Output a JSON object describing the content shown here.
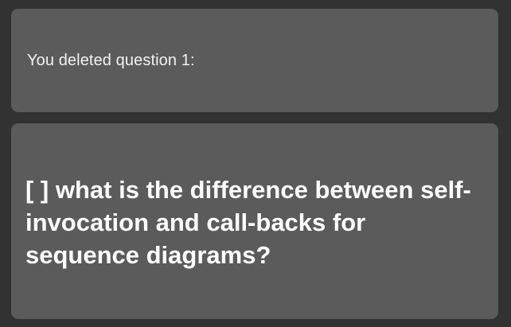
{
  "notice": {
    "text": "You deleted question 1:"
  },
  "question": {
    "text": "[ ] what is the difference between self-invocation and call-backs for sequence diagrams?"
  },
  "colors": {
    "background": "#323232",
    "card": "#5b5b5b",
    "text": "#ffffff"
  }
}
